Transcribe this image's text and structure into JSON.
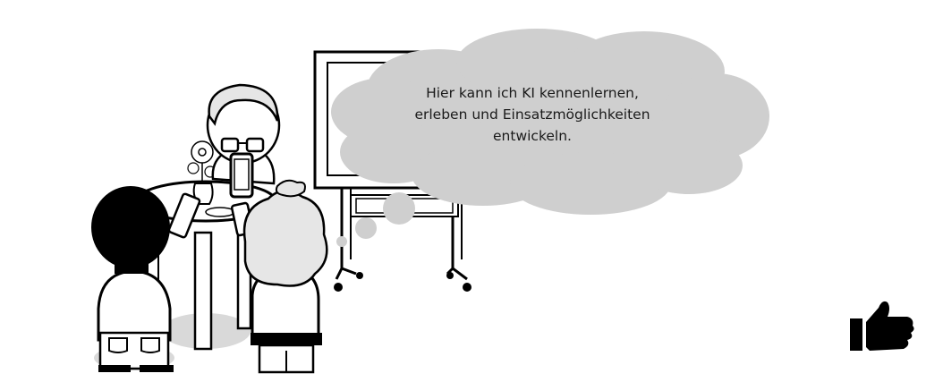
{
  "speech_bubble": {
    "line_1": "Hier kann ich KI kennenlernen,",
    "line_2": "erleben und Einsatzmöglichkeiten",
    "line_3": "entwickeln."
  },
  "icons": {
    "reaction": "thumbs-up-icon"
  },
  "colors": {
    "cloud_fill": "#cfcfcf",
    "ink": "#000000",
    "hair_gray": "#e6e6e6",
    "shadow_gray": "#d9d9d9"
  }
}
